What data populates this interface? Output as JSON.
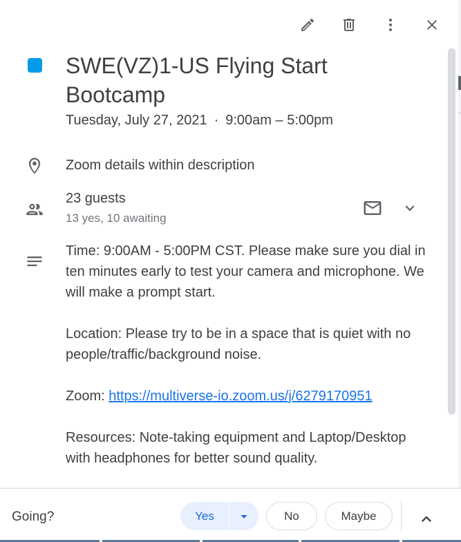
{
  "toolbar": {
    "edit_icon": "pencil-icon",
    "delete_icon": "trash-icon",
    "more_icon": "more-vert-icon",
    "close_icon": "close-icon"
  },
  "event": {
    "color": "#039be5",
    "title": "SWE(VZ)1-US Flying Start Bootcamp",
    "date": "Tuesday, July 27, 2021",
    "separator": "·",
    "time": "9:00am – 5:00pm"
  },
  "location": {
    "icon": "location-pin-icon",
    "text": "Zoom details within description"
  },
  "guests": {
    "icon": "people-icon",
    "count_label": "23 guests",
    "summary": "13 yes, 10 awaiting",
    "email_icon": "mail-icon",
    "expand_icon": "chevron-down-icon"
  },
  "description": {
    "icon": "notes-icon",
    "para1": "Time: 9:00AM - 5:00PM CST. Please make sure you dial in ten minutes early to test your camera and microphone. We will make a prompt start.",
    "para2": "Location: Please try to be in a space that is quiet with no people/traffic/background noise.",
    "zoom_prefix": "Zoom: ",
    "zoom_link": "https://multiverse-io.zoom.us/j/6279170951",
    "para4": "Resources: Note-taking equipment and Laptop/Desktop with headphones for better sound quality."
  },
  "rsvp": {
    "prompt": "Going?",
    "yes_label": "Yes",
    "no_label": "No",
    "maybe_label": "Maybe",
    "collapse_icon": "chevron-up-icon",
    "accent_color": "#1967d2"
  }
}
